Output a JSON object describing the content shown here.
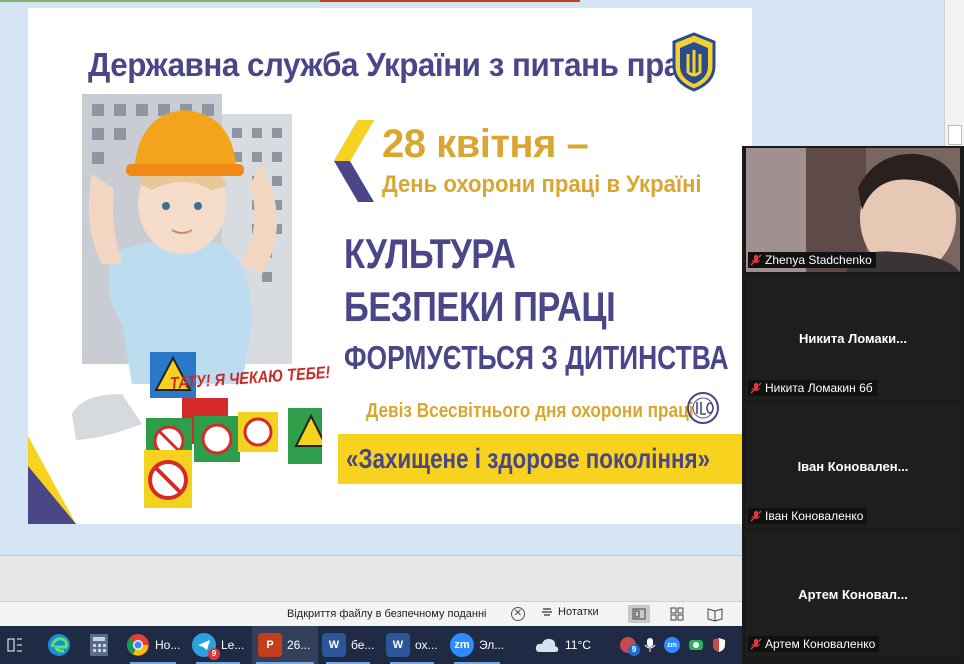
{
  "slide": {
    "agency_title": "Державна служба України з питань праці",
    "date_line": "28 квітня –",
    "day_line": "День охорони праці в Україні",
    "culture_line1": "КУЛЬТУРА",
    "culture_line2": "БЕЗПЕКИ ПРАЦІ",
    "childhood_line": "ФОРМУЄТЬСЯ З ДИТИНСТВА",
    "motto_line": "Девіз Всесвітнього дня охорони праці",
    "slogan": "«Захищене і здорове покоління»",
    "sign_text": "ТАТУ! Я ЧЕКАЮ ТЕБЕ!",
    "colors": {
      "purple": "#4a4688",
      "gold": "#d9a730",
      "yellow": "#f7d21e"
    }
  },
  "statusbar": {
    "protected_view": "Відкриття файлу в безпечному поданні",
    "close_symbol": "✕",
    "notes_label": "Нотатки"
  },
  "zoom": {
    "participants": [
      {
        "display_name": "",
        "tag": "Zhenya Stadchenko",
        "muted": true
      },
      {
        "display_name": "Никита  Ломаки...",
        "tag": "Никита Ломакин 6б",
        "muted": true
      },
      {
        "display_name": "Іван  Коновален...",
        "tag": "Іван Коноваленко",
        "muted": true
      },
      {
        "display_name": "Артем  Коновал...",
        "tag": "Артем Коноваленко",
        "muted": true
      }
    ]
  },
  "taskbar": {
    "items": [
      {
        "label": "Но...",
        "icon": "chrome-icon"
      },
      {
        "label": "Le...",
        "icon": "telegram-icon",
        "badge": "9"
      },
      {
        "label": "26...",
        "icon": "powerpoint-icon"
      },
      {
        "label": "бе...",
        "icon": "word-icon"
      },
      {
        "label": "ох...",
        "icon": "word-icon"
      },
      {
        "label": "Эл...",
        "icon": "zoom-icon"
      }
    ],
    "ppt_letter": "P",
    "word_letter": "W",
    "zoom_letter": "zm",
    "weather": "11°C",
    "tray_badge": "9"
  }
}
